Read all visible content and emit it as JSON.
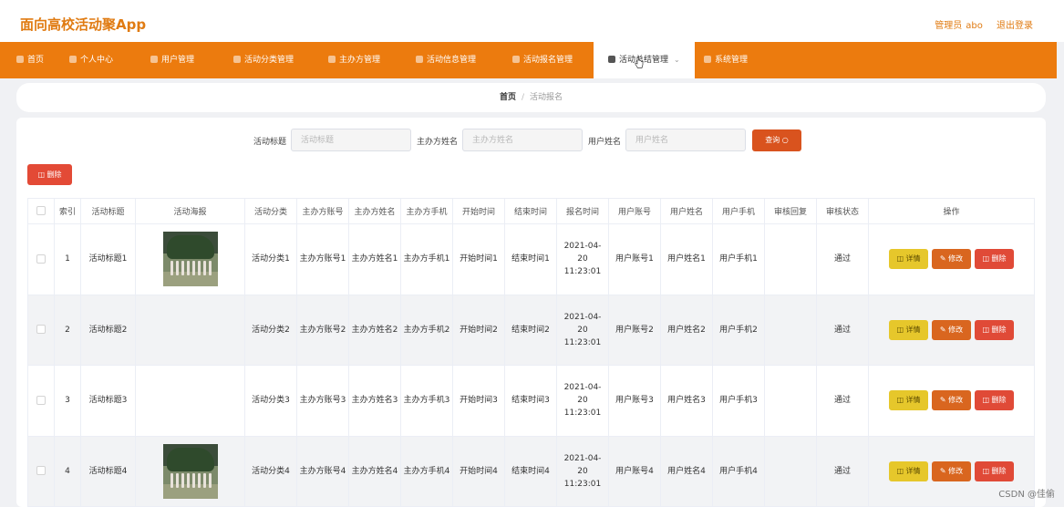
{
  "header": {
    "app_title": "面向高校活动聚App",
    "admin_label": "管理员",
    "admin_name": "abo",
    "logout_label": "退出登录"
  },
  "nav": {
    "items": [
      {
        "label": "首页",
        "icon": "home-icon"
      },
      {
        "label": "个人中心",
        "icon": "user-icon"
      },
      {
        "label": "用户管理",
        "icon": "grid-icon"
      },
      {
        "label": "活动分类管理",
        "icon": "tag-icon"
      },
      {
        "label": "主办方管理",
        "icon": "doc-icon"
      },
      {
        "label": "活动信息管理",
        "icon": "chart-icon"
      },
      {
        "label": "活动报名管理",
        "icon": "pin-icon"
      },
      {
        "label": "活动总结管理",
        "icon": "note-icon",
        "active": true
      },
      {
        "label": "系统管理",
        "icon": "folder-icon"
      }
    ]
  },
  "breadcrumb": {
    "home": "首页",
    "separator": "/",
    "current": "活动报名"
  },
  "search": {
    "title_label": "活动标题",
    "title_placeholder": "活动标题",
    "host_label": "主办方姓名",
    "host_placeholder": "主办方姓名",
    "user_label": "用户姓名",
    "user_placeholder": "用户姓名",
    "query_button": "查询 ○"
  },
  "toolbar": {
    "delete_button": "◫ 删除"
  },
  "table": {
    "columns": [
      "",
      "索引",
      "活动标题",
      "活动海报",
      "活动分类",
      "主办方账号",
      "主办方姓名",
      "主办方手机",
      "开始时间",
      "结束时间",
      "报名时间",
      "用户账号",
      "用户姓名",
      "用户手机",
      "审核回复",
      "审核状态",
      "操作"
    ],
    "rows": [
      {
        "index": "1",
        "title": "活动标题1",
        "poster": "photo",
        "category": "活动分类1",
        "host_account": "主办方账号1",
        "host_name": "主办方姓名1",
        "host_phone": "主办方手机1",
        "start": "开始时间1",
        "end": "结束时间1",
        "signup_time": "2021-04-20 11:23:01",
        "user_account": "用户账号1",
        "user_name": "用户姓名1",
        "user_phone": "用户手机1",
        "reply": "",
        "status": "通过"
      },
      {
        "index": "2",
        "title": "活动标题2",
        "poster": "none",
        "category": "活动分类2",
        "host_account": "主办方账号2",
        "host_name": "主办方姓名2",
        "host_phone": "主办方手机2",
        "start": "开始时间2",
        "end": "结束时间2",
        "signup_time": "2021-04-20 11:23:01",
        "user_account": "用户账号2",
        "user_name": "用户姓名2",
        "user_phone": "用户手机2",
        "reply": "",
        "status": "通过"
      },
      {
        "index": "3",
        "title": "活动标题3",
        "poster": "strip",
        "category": "活动分类3",
        "host_account": "主办方账号3",
        "host_name": "主办方姓名3",
        "host_phone": "主办方手机3",
        "start": "开始时间3",
        "end": "结束时间3",
        "signup_time": "2021-04-20 11:23:01",
        "user_account": "用户账号3",
        "user_name": "用户姓名3",
        "user_phone": "用户手机3",
        "reply": "",
        "status": "通过"
      },
      {
        "index": "4",
        "title": "活动标题4",
        "poster": "photo",
        "category": "活动分类4",
        "host_account": "主办方账号4",
        "host_name": "主办方姓名4",
        "host_phone": "主办方手机4",
        "start": "开始时间4",
        "end": "结束时间4",
        "signup_time": "2021-04-20 11:23:01",
        "user_account": "用户账号4",
        "user_name": "用户姓名4",
        "user_phone": "用户手机4",
        "reply": "",
        "status": "通过"
      }
    ],
    "actions": {
      "detail": "◫ 详情",
      "edit": "✎ 修改",
      "delete": "◫ 删除"
    }
  },
  "watermark": "CSDN @佳偷",
  "colors": {
    "brand_orange": "#ec7b0e",
    "title_orange": "#e07b12",
    "query_red": "#d9531e",
    "delete_red": "#e04a37",
    "detail_yellow": "#e6c72b",
    "edit_orange": "#d9661f"
  }
}
